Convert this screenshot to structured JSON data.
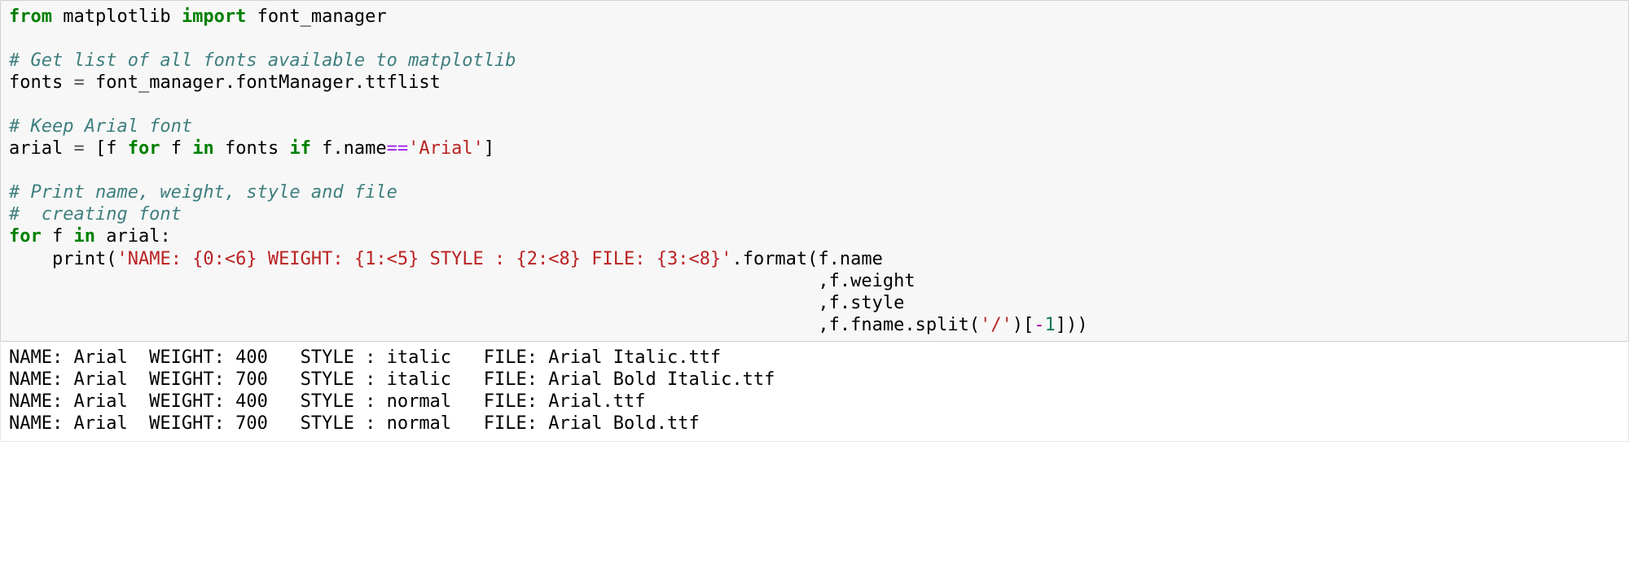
{
  "code": {
    "l1": {
      "kw1": "from",
      "mod": " matplotlib ",
      "kw2": "import",
      "rest": " font_manager"
    },
    "l3": {
      "cm": "# Get list of all fonts available to matplotlib"
    },
    "l4": {
      "a": "fonts ",
      "eq": "=",
      "b": " font_manager.fontManager.ttflist"
    },
    "l6": {
      "cm": "# Keep Arial font"
    },
    "l7": {
      "a": "arial ",
      "eq": "=",
      "b": " [f ",
      "kw1": "for",
      "c": " f ",
      "kw2": "in",
      "d": " fonts ",
      "kw3": "if",
      "e": " f.name",
      "op": "==",
      "str": "'Arial'",
      "f": "]"
    },
    "l9": {
      "cm": "# Print name, weight, style and file"
    },
    "l10": {
      "cm": "#  creating font"
    },
    "l11": {
      "kw1": "for",
      "a": " f ",
      "kw2": "in",
      "b": " arial:"
    },
    "l12": {
      "ind": "    ",
      "fn": "print",
      "p": "(",
      "str": "'NAME: {0:<6} WEIGHT: {1:<5} STYLE : {2:<8} FILE: {3:<8}'",
      "rest": ".format(f.name"
    },
    "l13": {
      "pad": "                                                                           ",
      "txt": ",f.weight"
    },
    "l14": {
      "pad": "                                                                           ",
      "txt": ",f.style"
    },
    "l15": {
      "pad": "                                                                           ",
      "a": ",f.fname.split(",
      "str": "'/'",
      "b": ")[",
      "neg": "-",
      "num": "1",
      "c": "]))"
    }
  },
  "output_lines": [
    "NAME: Arial  WEIGHT: 400   STYLE : italic   FILE: Arial Italic.ttf",
    "NAME: Arial  WEIGHT: 700   STYLE : italic   FILE: Arial Bold Italic.ttf",
    "NAME: Arial  WEIGHT: 400   STYLE : normal   FILE: Arial.ttf      ",
    "NAME: Arial  WEIGHT: 700   STYLE : normal   FILE: Arial Bold.ttf"
  ]
}
